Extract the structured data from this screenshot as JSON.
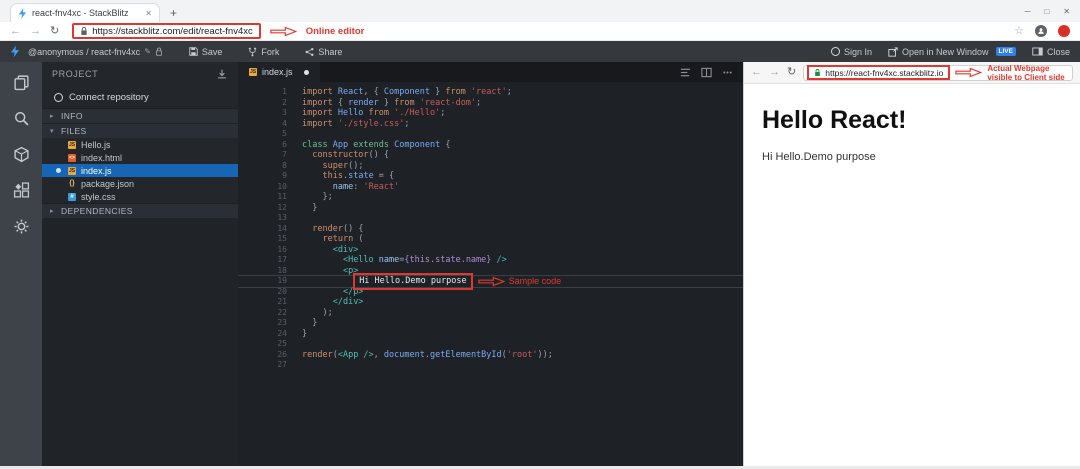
{
  "browser": {
    "tab_title": "react-fnv4xc - StackBlitz",
    "url": "https://stackblitz.com/edit/react-fnv4xc"
  },
  "annotations": {
    "online_editor": "Online editor",
    "sample_code": "Sample code",
    "actual_webpage_line1": "Actual Webpage",
    "actual_webpage_line2": "visible to Client side"
  },
  "toolbar": {
    "workspace": "@anonymous / react-fnv4xc",
    "save": "Save",
    "fork": "Fork",
    "share": "Share",
    "sign_in": "Sign In",
    "open_window": "Open in New Window",
    "live": "LIVE",
    "close": "Close"
  },
  "sidebar": {
    "panel_title": "PROJECT",
    "connect_repository": "Connect repository",
    "sections": {
      "info": "INFO",
      "files": "FILES",
      "dependencies": "DEPENDENCIES"
    },
    "icon_labels": {
      "js": "JS",
      "html": "<>",
      "json": "{}",
      "css": "#"
    },
    "files": [
      {
        "name": "Hello.js",
        "icon": "js",
        "selected": false,
        "modified": false
      },
      {
        "name": "index.html",
        "icon": "html",
        "selected": false,
        "modified": false
      },
      {
        "name": "index.js",
        "icon": "js",
        "selected": true,
        "modified": true
      },
      {
        "name": "package.json",
        "icon": "json",
        "selected": false,
        "modified": false
      },
      {
        "name": "style.css",
        "icon": "css",
        "selected": false,
        "modified": false
      }
    ]
  },
  "editor": {
    "tab_label": "index.js",
    "code": [
      {
        "n": 1,
        "t": [
          [
            "k",
            "import "
          ],
          [
            "i",
            "React"
          ],
          [
            "p",
            ", { "
          ],
          [
            "i",
            "Component"
          ],
          [
            "p",
            " } "
          ],
          [
            "k",
            "from "
          ],
          [
            "s",
            "'react'"
          ],
          [
            "p",
            ";"
          ]
        ]
      },
      {
        "n": 2,
        "t": [
          [
            "k",
            "import "
          ],
          [
            "p",
            "{ "
          ],
          [
            "i",
            "render"
          ],
          [
            "p",
            " } "
          ],
          [
            "k",
            "from "
          ],
          [
            "s",
            "'react-dom'"
          ],
          [
            "p",
            ";"
          ]
        ]
      },
      {
        "n": 3,
        "t": [
          [
            "k",
            "import "
          ],
          [
            "i",
            "Hello"
          ],
          [
            "k",
            " from "
          ],
          [
            "s",
            "'./Hello'"
          ],
          [
            "p",
            ";"
          ]
        ]
      },
      {
        "n": 4,
        "t": [
          [
            "k",
            "import "
          ],
          [
            "s",
            "'./style.css'"
          ],
          [
            "p",
            ";"
          ]
        ]
      },
      {
        "n": 5,
        "t": []
      },
      {
        "n": 6,
        "t": [
          [
            "c",
            "class "
          ],
          [
            "i",
            "App"
          ],
          [
            "c",
            " extends "
          ],
          [
            "i",
            "Component"
          ],
          [
            "p",
            " {"
          ]
        ]
      },
      {
        "n": 7,
        "t": [
          [
            "p",
            "  "
          ],
          [
            "k",
            "constructor"
          ],
          [
            "p",
            "() {"
          ]
        ]
      },
      {
        "n": 8,
        "t": [
          [
            "p",
            "    "
          ],
          [
            "k",
            "super"
          ],
          [
            "p",
            "();"
          ]
        ]
      },
      {
        "n": 9,
        "t": [
          [
            "p",
            "    "
          ],
          [
            "k",
            "this"
          ],
          [
            "p",
            "."
          ],
          [
            "i",
            "state"
          ],
          [
            "p",
            " = {"
          ]
        ]
      },
      {
        "n": 10,
        "t": [
          [
            "p",
            "      "
          ],
          [
            "a",
            "name"
          ],
          [
            "p",
            ": "
          ],
          [
            "s",
            "'React'"
          ]
        ]
      },
      {
        "n": 11,
        "t": [
          [
            "p",
            "    };"
          ]
        ]
      },
      {
        "n": 12,
        "t": [
          [
            "p",
            "  }"
          ]
        ]
      },
      {
        "n": 13,
        "t": []
      },
      {
        "n": 14,
        "t": [
          [
            "p",
            "  "
          ],
          [
            "k",
            "render"
          ],
          [
            "p",
            "() {"
          ]
        ]
      },
      {
        "n": 15,
        "t": [
          [
            "p",
            "    "
          ],
          [
            "k",
            "return"
          ],
          [
            "p",
            " ("
          ]
        ]
      },
      {
        "n": 16,
        "t": [
          [
            "p",
            "      "
          ],
          [
            "g",
            "<div>"
          ]
        ]
      },
      {
        "n": 17,
        "t": [
          [
            "p",
            "        "
          ],
          [
            "g",
            "<Hello"
          ],
          [
            "p",
            " "
          ],
          [
            "a",
            "name"
          ],
          [
            "p",
            "="
          ],
          [
            "e",
            "{this.state.name}"
          ],
          [
            "p",
            " "
          ],
          [
            "g",
            "/>"
          ]
        ]
      },
      {
        "n": 18,
        "t": [
          [
            "p",
            "        "
          ],
          [
            "g",
            "<p>"
          ]
        ]
      },
      {
        "n": 19,
        "current": true,
        "note": "sample_code",
        "t": [
          [
            "p",
            "          "
          ],
          [
            "x",
            "Hi Hello.Demo purpose"
          ]
        ]
      },
      {
        "n": 20,
        "t": [
          [
            "p",
            "        "
          ],
          [
            "g",
            "</p>"
          ]
        ]
      },
      {
        "n": 21,
        "t": [
          [
            "p",
            "      "
          ],
          [
            "g",
            "</div>"
          ]
        ]
      },
      {
        "n": 22,
        "t": [
          [
            "p",
            "    );"
          ]
        ]
      },
      {
        "n": 23,
        "t": [
          [
            "p",
            "  }"
          ]
        ]
      },
      {
        "n": 24,
        "t": [
          [
            "p",
            "}"
          ]
        ]
      },
      {
        "n": 25,
        "t": []
      },
      {
        "n": 26,
        "t": [
          [
            "k",
            "render"
          ],
          [
            "p",
            "("
          ],
          [
            "g",
            "<App />"
          ],
          [
            "p",
            ", "
          ],
          [
            "i",
            "document"
          ],
          [
            "p",
            "."
          ],
          [
            "i",
            "getElementById"
          ],
          [
            "p",
            "("
          ],
          [
            "s",
            "'root'"
          ],
          [
            "p",
            "));"
          ]
        ]
      },
      {
        "n": 27,
        "t": []
      }
    ]
  },
  "preview": {
    "url": "https://react-fnv4xc.stackblitz.io",
    "heading": "Hello React!",
    "body": "Hi Hello.Demo purpose"
  },
  "colors": {
    "annotation_red": "#e0382e",
    "stackblitz_blue": "#3aa0f2",
    "live_badge_blue": "#2f80ed",
    "selected_file_blue": "#1766b5",
    "lock_green": "#1a8f3c",
    "editor_background": "#1e2227"
  }
}
